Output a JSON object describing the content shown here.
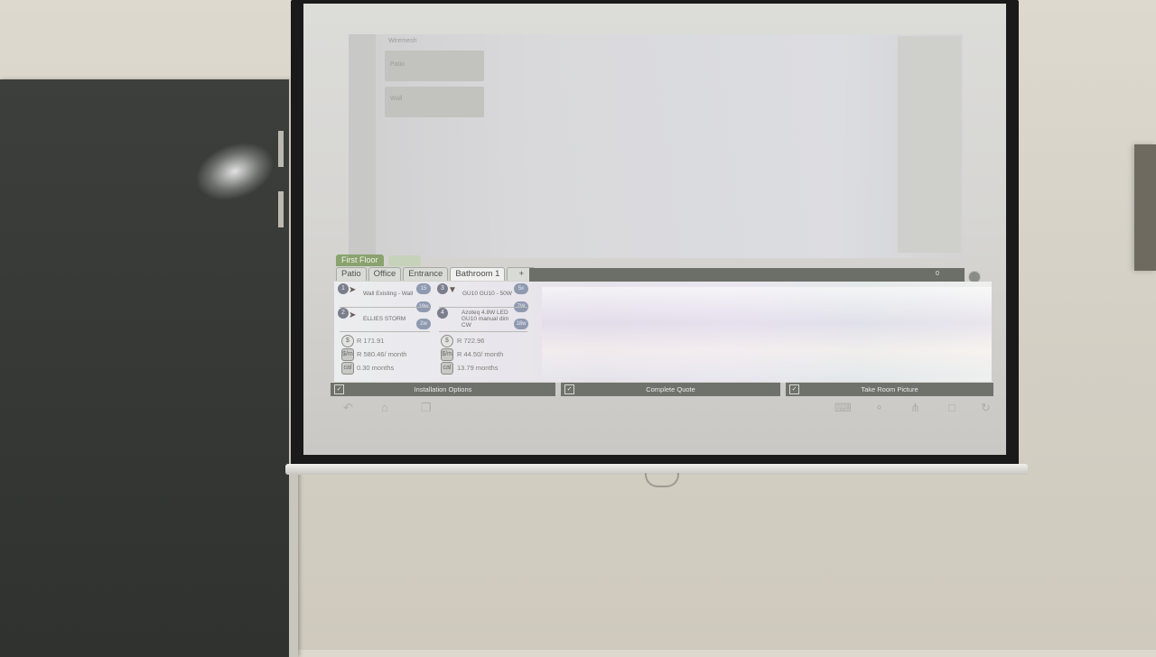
{
  "scene": {
    "colors": {
      "wall": "#d6d2c7",
      "door": "#353835",
      "screen": "#dbdbd8",
      "accent_green": "#8aa26e",
      "button_bg": "#6f716b"
    }
  },
  "app": {
    "floor_tab": "First Floor",
    "room_tabs": [
      "Patio",
      "Office",
      "Entrance",
      "Bathroom 1",
      "+"
    ],
    "active_room": "Bathroom 1",
    "count": "0",
    "items": [
      {
        "num": "1",
        "label": "Wall Existing - Wall",
        "qty": "15",
        "qty2": "18w",
        "icon": "wall-light-icon"
      },
      {
        "num": "2",
        "label": "ELLIES STORM",
        "qty": "2w",
        "icon": "spot-light-icon"
      },
      {
        "num": "3",
        "label": "GU10 GU10 - 50W",
        "qty": "5x",
        "qty2": "7W",
        "icon": "downlight-icon"
      },
      {
        "num": "4",
        "label": "Azoteq 4.8W LED GU10 manual dim CW",
        "qty": "18w",
        "icon": "bulb-icon"
      }
    ],
    "stats_left": [
      {
        "icon": "$",
        "value": "R 171.91"
      },
      {
        "icon": "$/m",
        "value": "R 580.46/ month"
      },
      {
        "icon": "cal",
        "value": "0.30 months"
      }
    ],
    "stats_right": [
      {
        "icon": "$",
        "value": "R 722.96"
      },
      {
        "icon": "$/m",
        "value": "R 44.50/ month"
      },
      {
        "icon": "cal",
        "value": "13.79 months"
      }
    ],
    "buttons": {
      "installation": "Installation Options",
      "complete": "Complete Quote",
      "picture": "Take Room Picture"
    },
    "ghost": {
      "header": "Wiremesh",
      "card1": "Patio",
      "card2": "Wall"
    },
    "nav_icons": [
      "back-icon",
      "home-icon",
      "recents-icon",
      "keyboard-icon",
      "mic-icon",
      "share-icon",
      "window-icon",
      "refresh-icon"
    ]
  }
}
